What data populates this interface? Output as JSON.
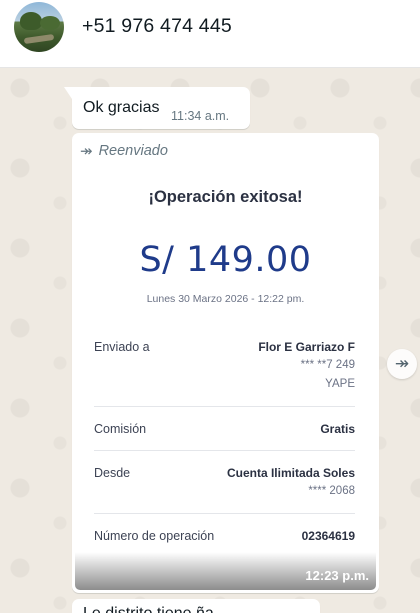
{
  "header": {
    "contact_name": "+51 976 474 445"
  },
  "messages": {
    "ok": {
      "text": "Ok gracias",
      "time": "11:34 a.m."
    },
    "forwarded": {
      "label": "Reenviado",
      "time": "12:23 p.m.",
      "receipt": {
        "title": "¡Operación exitosa!",
        "amount": "S/ 149.00",
        "date": "Lunes 30 Marzo 2026 - 12:22 pm.",
        "rows": [
          {
            "label": "Enviado a",
            "value": "Flor E Garriazo F",
            "sub1": "*** **7 249",
            "sub2": "YAPE"
          },
          {
            "label": "Comisión",
            "value": "Gratis"
          },
          {
            "label": "Desde",
            "value": "Cuenta Ilimitada Soles",
            "sub1": "**** 2068"
          },
          {
            "label": "Número de operación",
            "value": "02364619"
          }
        ]
      }
    },
    "next": {
      "text": "Le distrito tiene ña"
    }
  },
  "icons": {
    "forward": "forward-arrow-icon",
    "share": "forward-share-icon"
  }
}
